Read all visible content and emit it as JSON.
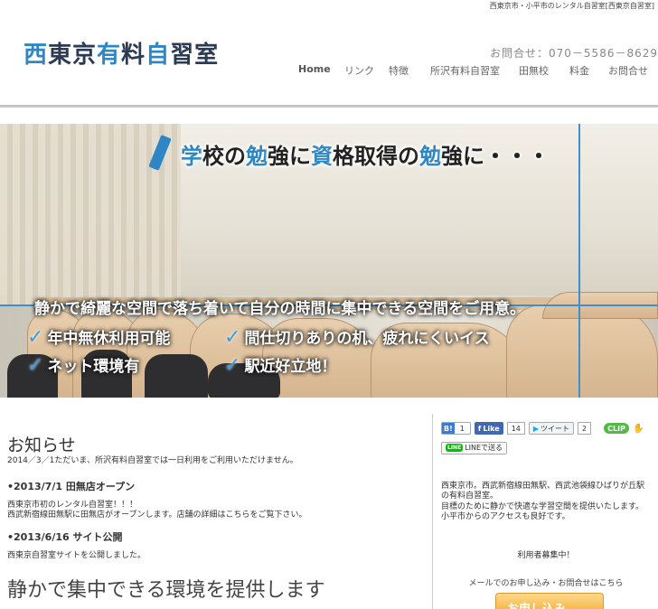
{
  "header": {
    "top_caption": "西東京市・小平市のレンタル自習室[西東京自習室]",
    "logo": {
      "part1": "西",
      "part2": "東京",
      "part3": "有",
      "part4": "料",
      "part5": "自",
      "part6": "習室"
    },
    "contact": "お問合せ：070－5586－8629",
    "nav": [
      "Home",
      "リンク",
      "特徴",
      "所沢有料自習室",
      "田無校",
      "料金",
      "お問合せ"
    ]
  },
  "hero": {
    "headline_parts": [
      "学",
      "校の",
      "勉",
      "強に",
      "資",
      "格取得の",
      "勉",
      "強に・・・"
    ],
    "tagline": "静かで綺麗な空間で落ち着いて自分の時間に集中できる空間をご用意。",
    "features": [
      "年中無休利用可能",
      "間仕切りありの机、疲れにくいイス",
      "ネット環境有",
      "駅近好立地！"
    ]
  },
  "main": {
    "news_title": "お知らせ",
    "news_line1": "2014／3／1ただいま、所沢有料自習室では一日利用をご利用いただけません。",
    "item1_title": "•2013/7/1 田無店オープン",
    "item1_l1": "西東京市初のレンタル自習室！！！",
    "item1_l2": "西武新宿線田無駅に田無店がオープンします。店舗の詳細はこちらをご覧下さい。",
    "item2_title": "•2013/6/16 サイト公開",
    "item2_l1": "西東京自習室サイトを公開しました。",
    "big_heading": "静かで集中できる環境を提供します"
  },
  "sidebar": {
    "hatena_label": "B!",
    "hatena_count": "1",
    "fb_label": "Like",
    "fb_count": "14",
    "tw_label": "ツイート",
    "tw_count": "2",
    "clip_label": "CLIP",
    "line_icon": "LINE",
    "line_label": "LINEで送る",
    "desc_l1": "西東京市。西武新宿線田無駅、西武池袋線ひばりが丘駅",
    "desc_l2": "の有料自習室。",
    "desc_l3": "目標のために静かで快適な学習空間を提供いたします。",
    "desc_l4": "小平市からのアクセスも良好です。",
    "recruit": "利用者募集中！",
    "contact_text": "メールでのお申し込み・お問合せはこちら",
    "apply_label": "お申し込み"
  }
}
